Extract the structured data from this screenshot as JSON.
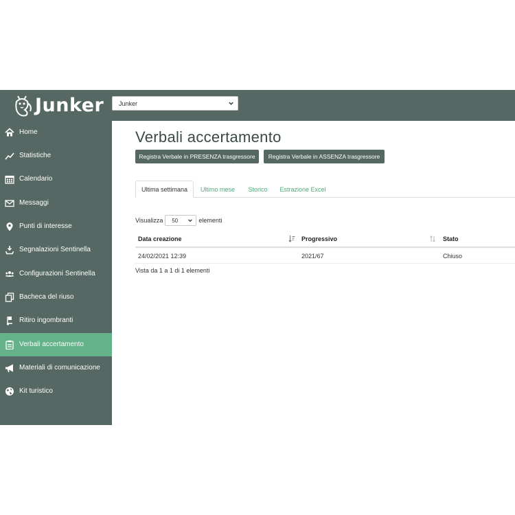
{
  "app": {
    "logo_text": "Junker"
  },
  "header": {
    "org_select_value": "Junker"
  },
  "sidebar": {
    "items": [
      {
        "label": "Home",
        "icon": "home-icon"
      },
      {
        "label": "Statistiche",
        "icon": "chart-line-icon"
      },
      {
        "label": "Calendario",
        "icon": "calendar-icon"
      },
      {
        "label": "Messaggi",
        "icon": "envelope-icon"
      },
      {
        "label": "Punti di interesse",
        "icon": "map-marker-icon"
      },
      {
        "label": "Segnalazioni Sentinella",
        "icon": "report-icon"
      },
      {
        "label": "Configurazioni Sentinella",
        "icon": "users-icon"
      },
      {
        "label": "Bacheca del riuso",
        "icon": "copy-icon"
      },
      {
        "label": "Ritiro ingombranti",
        "icon": "dolly-icon"
      },
      {
        "label": "Verbali accertamento",
        "icon": "clipboard-icon",
        "active": true
      },
      {
        "label": "Materiali di comunicazione",
        "icon": "bullhorn-icon"
      },
      {
        "label": "Kit turistico",
        "icon": "globe-icon"
      }
    ],
    "active_color": "#64b18a",
    "bg_color": "#566863"
  },
  "main": {
    "title": "Verbali accertamento",
    "actions": {
      "presenza": "Registra Verbale in PRESENZA trasgressore",
      "assenza": "Registra Verbale in ASSENZA trasgressore"
    },
    "tabs": [
      {
        "label": "Ultima settimana",
        "active": true
      },
      {
        "label": "Ultimo mese"
      },
      {
        "label": "Storico"
      },
      {
        "label": "Estrazione Excel"
      }
    ],
    "length": {
      "prefix": "Visualizza",
      "value": "50",
      "suffix": "elementi"
    },
    "table": {
      "columns": [
        "Data creazione",
        "Progressivo",
        "Stato"
      ],
      "rows": [
        [
          "24/02/2021 12:39",
          "2021/67",
          "Chiuso"
        ]
      ],
      "info": "Vista da 1 a 1 di 1 elementi"
    }
  }
}
